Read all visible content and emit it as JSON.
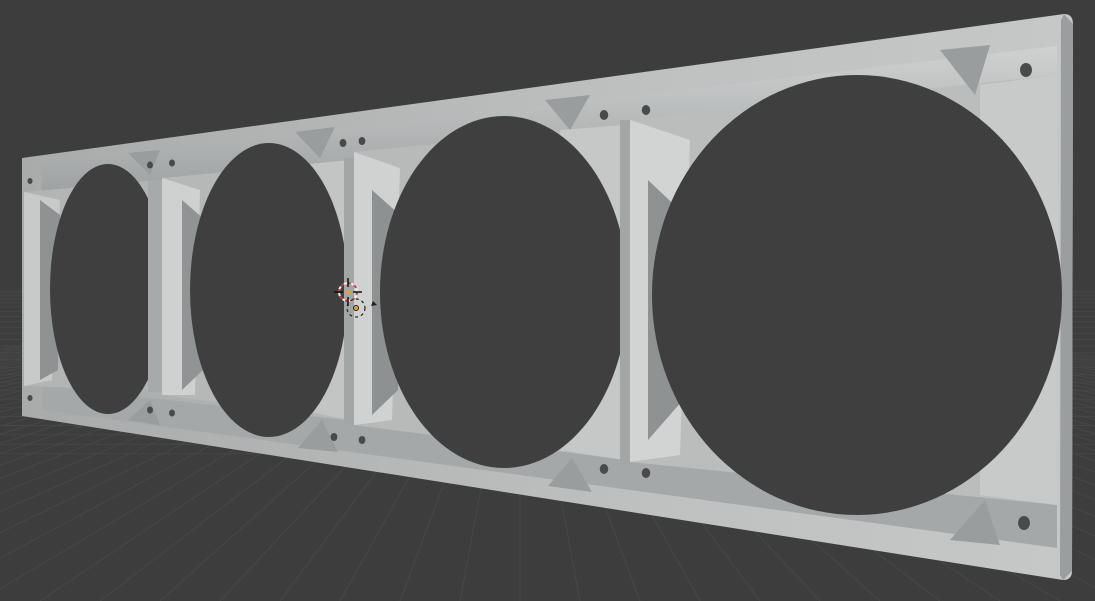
{
  "viewport": {
    "background_color": "#3d3d3d",
    "grid_color": "#474747",
    "model_color": "#b9bbbb",
    "model_shadow_color": "#8f9292",
    "model_highlight_color": "#d3d5d5",
    "opening_color": "#3f3f3f",
    "cursor_color_red": "#d33b3b",
    "cursor_color_white": "#f0f0f0",
    "model": "fan-shroud-bracket",
    "fan_openings": 4
  }
}
